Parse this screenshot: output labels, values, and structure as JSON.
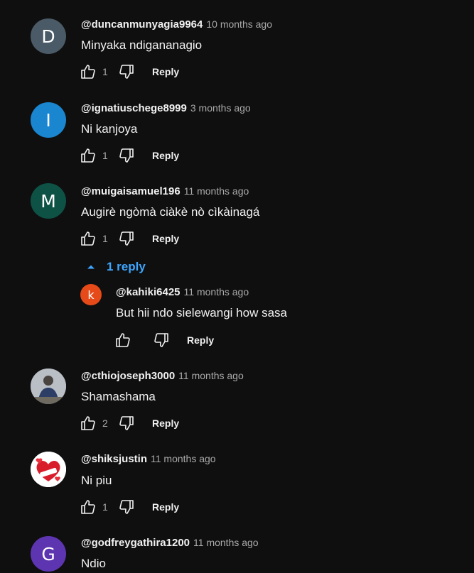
{
  "colors": {
    "background": "#0f0f0f",
    "accent": "#3ea6ff"
  },
  "reply_label": "Reply",
  "comments": [
    {
      "avatar_letter": "D",
      "avatar_color": "#4a5a66",
      "author": "@duncanmunyagia9964",
      "time": "10 months ago",
      "text": "Minyaka ndigananagio",
      "likes": "1"
    },
    {
      "avatar_letter": "I",
      "avatar_color": "#1a86d0",
      "author": "@ignatiuschege8999",
      "time": "3 months ago",
      "text": "Ni kanjoya",
      "likes": "1"
    },
    {
      "avatar_letter": "M",
      "avatar_color": "#0e5246",
      "author": "@muigaisamuel196",
      "time": "11 months ago",
      "text": "Augirè ngòmà ciàkè nò cìkàinagá",
      "likes": "1"
    },
    {
      "avatar_letter": "",
      "avatar_color": "#8a8a8a",
      "author": "@cthiojoseph3000",
      "time": "11 months ago",
      "text": "Shamashama",
      "likes": "2"
    },
    {
      "avatar_letter": "",
      "avatar_color": "#ffffff",
      "author": "@shiksjustin",
      "time": "11 months ago",
      "text": "Ni piu",
      "likes": "1"
    },
    {
      "avatar_letter": "G",
      "avatar_color": "#5e35b1",
      "author": "@godfreygathira1200",
      "time": "11 months ago",
      "text": "Ndio",
      "likes": ""
    }
  ],
  "replies_toggle": "1 reply",
  "reply": {
    "avatar_letter": "k",
    "avatar_color": "#e64a19",
    "author": "@kahiki6425",
    "time": "11 months ago",
    "text": "But hii ndo sielewangi how sasa",
    "likes": ""
  },
  "icons": [
    "like-icon",
    "dislike-icon",
    "chevron-up-icon"
  ]
}
